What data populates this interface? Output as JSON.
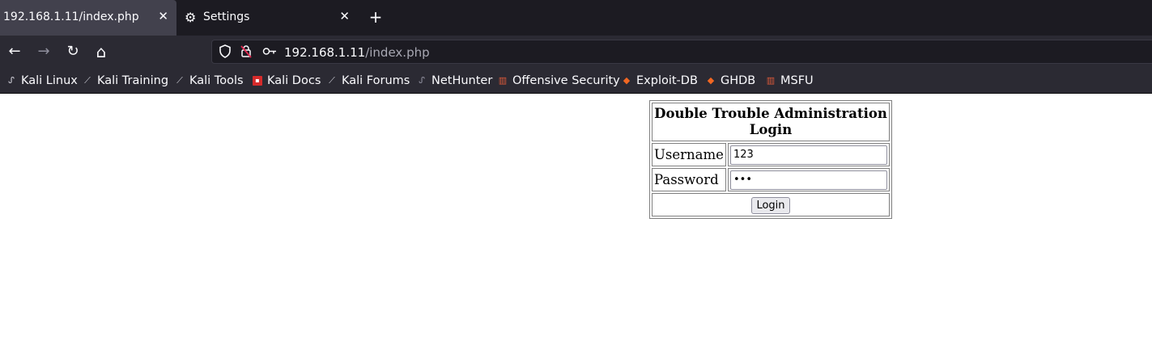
{
  "tabs": [
    {
      "title": "192.168.1.11/index.php",
      "active": true
    },
    {
      "title": "Settings",
      "active": false,
      "icon": "gear-icon"
    }
  ],
  "nav": {
    "back_icon": "←",
    "forward_icon": "→",
    "reload_icon": "↻",
    "home_icon": "⌂",
    "url_host": "192.168.1.11",
    "url_path": "/index.php"
  },
  "bookmarks": [
    {
      "label": "Kali Linux",
      "icon": "kali-dragon-icon"
    },
    {
      "label": "Kali Training",
      "icon": "kali-dragon-icon"
    },
    {
      "label": "Kali Tools",
      "icon": "kali-dragon-icon"
    },
    {
      "label": "Kali Docs",
      "icon": "kali-docs-icon"
    },
    {
      "label": "Kali Forums",
      "icon": "kali-dragon-icon"
    },
    {
      "label": "NetHunter",
      "icon": "nethunter-icon"
    },
    {
      "label": "Offensive Security",
      "icon": "offsec-icon"
    },
    {
      "label": "Exploit-DB",
      "icon": "exploitdb-icon"
    },
    {
      "label": "GHDB",
      "icon": "exploitdb-icon"
    },
    {
      "label": "MSFU",
      "icon": "offsec-icon"
    }
  ],
  "login": {
    "heading": "Double Trouble Administration Login",
    "username_label": "Username",
    "username_value": "123",
    "password_label": "Password",
    "password_value": "123",
    "button_label": "Login"
  },
  "colors": {
    "tabbar_bg": "#1c1b22",
    "toolbar_bg": "#2b2a33",
    "active_tab_bg": "#42414d",
    "text_light": "#fbfbfe"
  }
}
